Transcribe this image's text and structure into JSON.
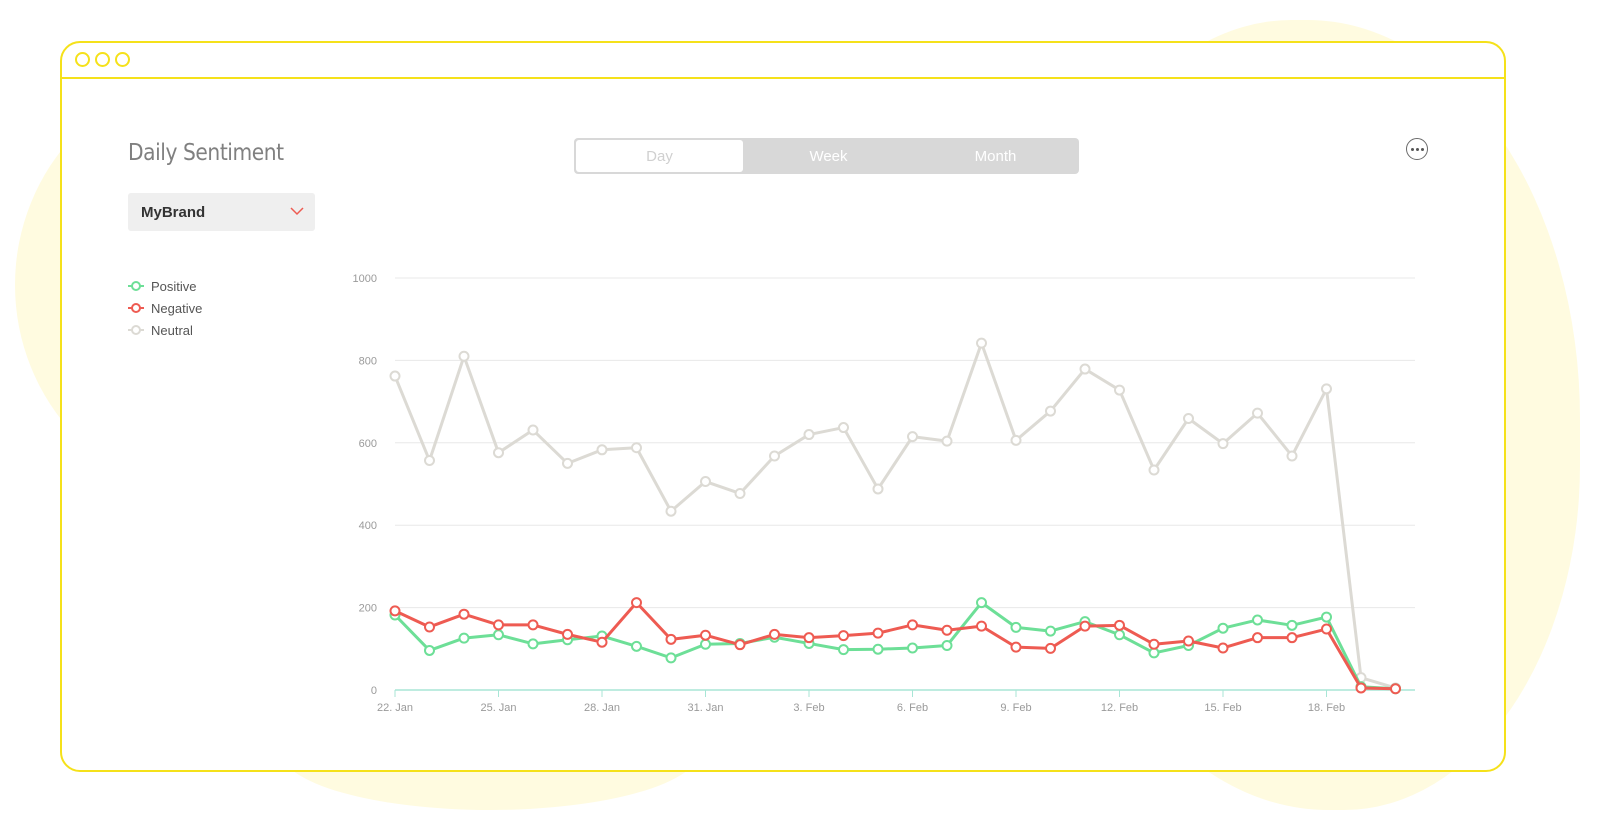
{
  "title": "Daily Sentiment",
  "period_toggle": {
    "options": [
      "Day",
      "Week",
      "Month"
    ],
    "selected": "Day"
  },
  "brand_select": {
    "value": "MyBrand"
  },
  "icons": {
    "more": "more-horizontal-icon",
    "caret": "chevron-down-icon"
  },
  "colors": {
    "frame": "#f5e11a",
    "positive": "#6ddf97",
    "negative": "#ee5b52",
    "neutral": "#dcdad4",
    "caret": "#ee5b52"
  },
  "legend": [
    {
      "label": "Positive",
      "color": "#6ddf97"
    },
    {
      "label": "Negative",
      "color": "#ee5b52"
    },
    {
      "label": "Neutral",
      "color": "#dcdad4"
    }
  ],
  "chart_data": {
    "type": "line",
    "ylim": [
      0,
      1000
    ],
    "yticks": [
      "0",
      "200",
      "400",
      "600",
      "800",
      "1000"
    ],
    "xticks": [
      {
        "label": "22. Jan",
        "index": 0
      },
      {
        "label": "25. Jan",
        "index": 3
      },
      {
        "label": "28. Jan",
        "index": 6
      },
      {
        "label": "31. Jan",
        "index": 9
      },
      {
        "label": "3. Feb",
        "index": 12
      },
      {
        "label": "6. Feb",
        "index": 15
      },
      {
        "label": "9. Feb",
        "index": 18
      },
      {
        "label": "12. Feb",
        "index": 21
      },
      {
        "label": "15. Feb",
        "index": 24
      },
      {
        "label": "18. Feb",
        "index": 27
      }
    ],
    "x": [
      "22. Jan",
      "23. Jan",
      "24. Jan",
      "25. Jan",
      "26. Jan",
      "27. Jan",
      "28. Jan",
      "29. Jan",
      "30. Jan",
      "31. Jan",
      "1. Feb",
      "2. Feb",
      "3. Feb",
      "4. Feb",
      "5. Feb",
      "6. Feb",
      "7. Feb",
      "8. Feb",
      "9. Feb",
      "10. Feb",
      "11. Feb",
      "12. Feb",
      "13. Feb",
      "14. Feb",
      "15. Feb",
      "16. Feb",
      "17. Feb",
      "18. Feb",
      "19. Feb",
      "20. Feb"
    ],
    "grid": true,
    "legend_position": "left",
    "series": [
      {
        "name": "Positive",
        "color": "#6ddf97",
        "values": [
          182,
          96,
          126,
          134,
          112,
          122,
          131,
          106,
          78,
          111,
          113,
          128,
          113,
          98,
          99,
          102,
          108,
          212,
          152,
          143,
          166,
          134,
          90,
          108,
          150,
          170,
          157,
          177,
          8,
          3
        ]
      },
      {
        "name": "Negative",
        "color": "#ee5b52",
        "values": [
          192,
          153,
          184,
          158,
          158,
          135,
          116,
          212,
          123,
          133,
          110,
          135,
          127,
          132,
          138,
          158,
          145,
          155,
          104,
          101,
          155,
          157,
          111,
          119,
          102,
          127,
          127,
          148,
          5,
          3
        ]
      },
      {
        "name": "Neutral",
        "color": "#dcdad4",
        "values": [
          762,
          557,
          810,
          576,
          631,
          550,
          583,
          588,
          434,
          506,
          477,
          568,
          620,
          637,
          488,
          615,
          604,
          842,
          606,
          677,
          779,
          728,
          534,
          659,
          598,
          672,
          568,
          731,
          30,
          5
        ]
      }
    ]
  }
}
